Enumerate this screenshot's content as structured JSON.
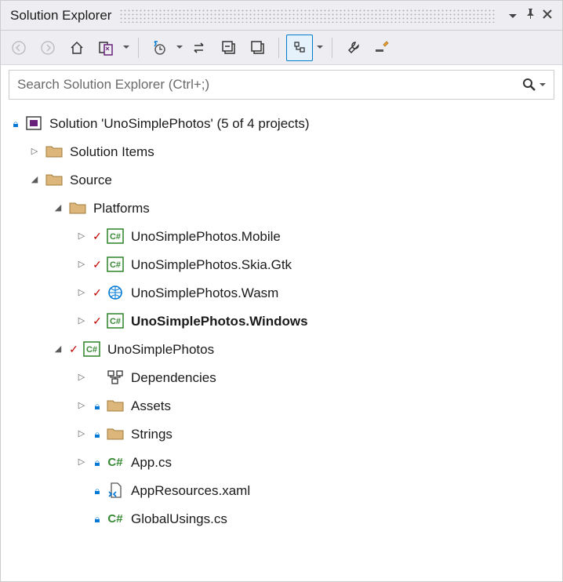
{
  "panel": {
    "title": "Solution Explorer"
  },
  "search": {
    "placeholder": "Search Solution Explorer (Ctrl+;)"
  },
  "tree": {
    "solution_label": "Solution 'UnoSimplePhotos' (5 of 4 projects)",
    "solution_items": "Solution Items",
    "source": "Source",
    "platforms": "Platforms",
    "proj_mobile": "UnoSimplePhotos.Mobile",
    "proj_skia": "UnoSimplePhotos.Skia.Gtk",
    "proj_wasm": "UnoSimplePhotos.Wasm",
    "proj_windows": "UnoSimplePhotos.Windows",
    "proj_main": "UnoSimplePhotos",
    "dependencies": "Dependencies",
    "assets": "Assets",
    "strings": "Strings",
    "app_cs": "App.cs",
    "appres": "AppResources.xaml",
    "globalusings": "GlobalUsings.cs"
  }
}
